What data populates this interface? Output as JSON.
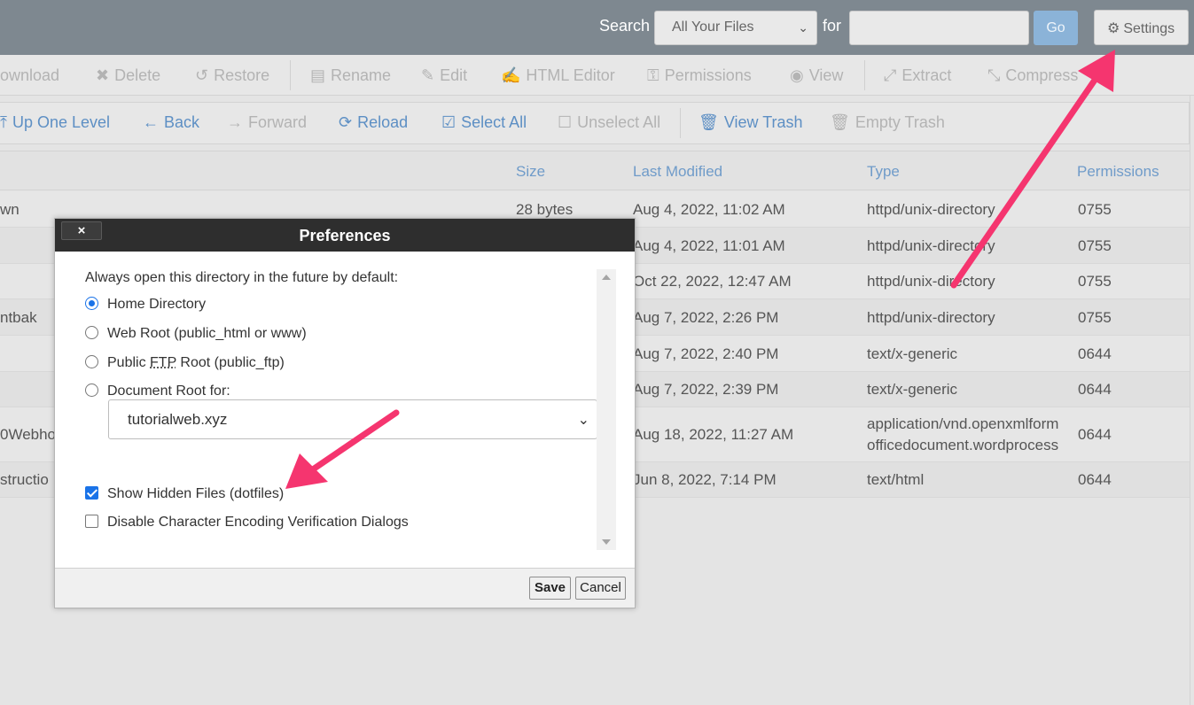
{
  "search": {
    "label": "Search",
    "scope_value": "All Your Files",
    "for_label": "for",
    "query_value": "",
    "go_label": "Go",
    "settings_label": "Settings"
  },
  "toolbar_actions": [
    {
      "label": "ownload",
      "icon": "download-icon",
      "glyph": ""
    },
    {
      "label": "Delete",
      "icon": "delete-icon",
      "glyph": "✖"
    },
    {
      "label": "Restore",
      "icon": "restore-icon",
      "glyph": "↺"
    },
    {
      "label": "Rename",
      "icon": "rename-icon",
      "glyph": "▤"
    },
    {
      "label": "Edit",
      "icon": "edit-icon",
      "glyph": "✎"
    },
    {
      "label": "HTML Editor",
      "icon": "html-editor-icon",
      "glyph": "✍"
    },
    {
      "label": "Permissions",
      "icon": "permissions-icon",
      "glyph": "⚿"
    },
    {
      "label": "View",
      "icon": "view-icon",
      "glyph": "◉"
    },
    {
      "label": "Extract",
      "icon": "extract-icon",
      "glyph": "⤢"
    },
    {
      "label": "Compress",
      "icon": "compress-icon",
      "glyph": "⤡"
    }
  ],
  "nav_actions": [
    {
      "label": "Up One Level",
      "icon": "up-level-icon",
      "glyph": "⤒"
    },
    {
      "label": "Back",
      "icon": "back-arrow-icon",
      "glyph": "←"
    },
    {
      "label": "Forward",
      "icon": "forward-arrow-icon",
      "glyph": "→"
    },
    {
      "label": "Reload",
      "icon": "reload-icon",
      "glyph": "⟳"
    },
    {
      "label": "Select All",
      "icon": "select-all-icon",
      "glyph": "☑"
    },
    {
      "label": "Unselect All",
      "icon": "unselect-all-icon",
      "glyph": "☐"
    },
    {
      "label": "View Trash",
      "icon": "trash-icon",
      "glyph": "🗑"
    },
    {
      "label": "Empty Trash",
      "icon": "empty-trash-icon",
      "glyph": "🗑"
    }
  ],
  "table": {
    "headers": {
      "size": "Size",
      "modified": "Last Modified",
      "type": "Type",
      "permissions": "Permissions"
    },
    "rows": [
      {
        "name": "wn",
        "size": "28 bytes",
        "modified": "Aug 4, 2022, 11:02 AM",
        "type": "httpd/unix-directory",
        "type2": "",
        "perms": "0755"
      },
      {
        "name": "",
        "size": "",
        "modified": "Aug 4, 2022, 11:01 AM",
        "type": "httpd/unix-directory",
        "type2": "",
        "perms": "0755"
      },
      {
        "name": "",
        "size": "",
        "modified": "Oct 22, 2022, 12:47 AM",
        "type": "httpd/unix-directory",
        "type2": "",
        "perms": "0755"
      },
      {
        "name": "ntbak",
        "size": "",
        "modified": "Aug 7, 2022, 2:26 PM",
        "type": "httpd/unix-directory",
        "type2": "",
        "perms": "0755"
      },
      {
        "name": "",
        "size": "",
        "modified": "Aug 7, 2022, 2:40 PM",
        "type": "text/x-generic",
        "type2": "",
        "perms": "0644"
      },
      {
        "name": "",
        "size": "",
        "modified": "Aug 7, 2022, 2:39 PM",
        "type": "text/x-generic",
        "type2": "",
        "perms": "0644"
      },
      {
        "name": "0Webho",
        "size": "",
        "modified": "Aug 18, 2022, 11:27 AM",
        "type": "application/vnd.openxmlform",
        "type2": "officedocument.wordprocess",
        "perms": "0644"
      },
      {
        "name": "structio",
        "size": "",
        "modified": "Jun 8, 2022, 7:14 PM",
        "type": "text/html",
        "type2": "",
        "perms": "0644"
      }
    ]
  },
  "preferences": {
    "title": "Preferences",
    "close_label": "×",
    "intro": "Always open this directory in the future by default:",
    "options": {
      "home": "Home Directory",
      "webroot": "Web Root (public_html or www)",
      "ftp_prefix": "Public ",
      "ftp_abbr": "FTP",
      "ftp_suffix": " Root (public_ftp)",
      "docroot": "Document Root for:"
    },
    "selected_option": "home",
    "docroot_domain": "tutorialweb.xyz",
    "show_hidden_label": "Show Hidden Files (dotfiles)",
    "show_hidden_checked": true,
    "disable_encoding_label": "Disable Character Encoding Verification Dialogs",
    "disable_encoding_checked": false,
    "save_label": "Save",
    "cancel_label": "Cancel"
  },
  "colors": {
    "topbar": "#7e8890",
    "link_blue": "#5d8fc4",
    "annotation_arrow": "#f5356f",
    "checkbox_blue": "#1a73e8"
  }
}
